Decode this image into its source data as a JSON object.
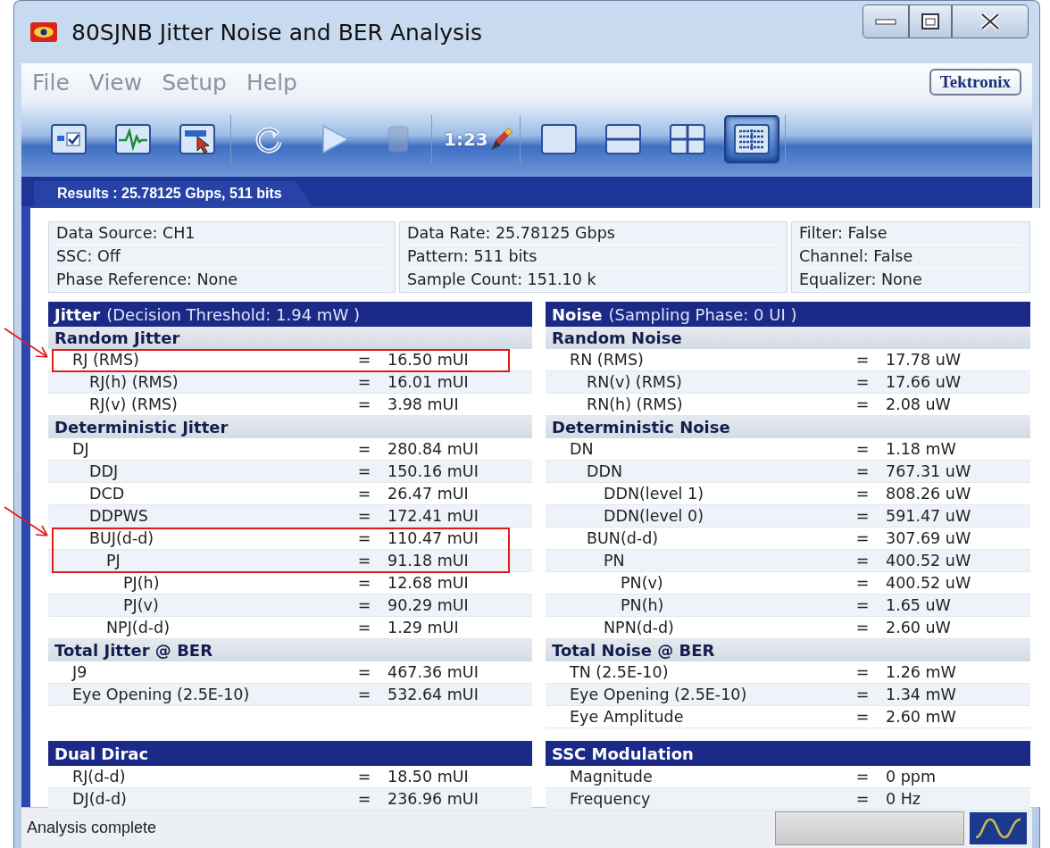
{
  "window": {
    "title": "80SJNB Jitter Noise and BER Analysis"
  },
  "menu": [
    "File",
    "View",
    "Setup",
    "Help"
  ],
  "brand": "Tektronix",
  "toolbar": [
    [
      {
        "kind": "summary",
        "selected": false,
        "disabled": false
      },
      {
        "kind": "waveform",
        "selected": false,
        "disabled": false
      },
      {
        "kind": "select",
        "selected": false,
        "disabled": false
      }
    ],
    [
      {
        "kind": "refresh",
        "selected": false,
        "disabled": false
      },
      {
        "kind": "run",
        "selected": false,
        "disabled": false
      },
      {
        "kind": "stop",
        "selected": false,
        "disabled": true
      }
    ],
    [
      {
        "kind": "numbers",
        "label": "1:23",
        "selected": false,
        "disabled": false
      }
    ],
    [
      {
        "kind": "layout-one",
        "selected": false,
        "disabled": false
      },
      {
        "kind": "layout-two",
        "selected": false,
        "disabled": false
      },
      {
        "kind": "layout-four",
        "selected": false,
        "disabled": false
      },
      {
        "kind": "layout-table",
        "selected": true,
        "disabled": false
      }
    ]
  ],
  "results_tab": {
    "label": "Results : 25.78125 Gbps, 511 bits"
  },
  "info": [
    [
      "Data Source: CH1",
      "SSC: Off",
      "Phase Reference: None"
    ],
    [
      "Data Rate: 25.78125 Gbps",
      "Pattern: 511 bits",
      "Sample Count: 151.10 k"
    ],
    [
      "Filter: False",
      "Channel: False",
      "Equalizer: None"
    ]
  ],
  "left_column": [
    {
      "title": "Jitter",
      "subtitle": "(Decision Threshold: 1.94 mW )",
      "sections": [
        {
          "title": "Random Jitter",
          "rows": [
            {
              "label": "RJ (RMS)",
              "sign": "=",
              "value": "16.50 mUI",
              "highlighted": true,
              "children": [
                {
                  "label": "RJ(h) (RMS)",
                  "sign": "=",
                  "value": "16.01 mUI",
                  "highlighted": false
                },
                {
                  "label": "RJ(v) (RMS)",
                  "sign": "=",
                  "value": "3.98 mUI",
                  "highlighted": false
                }
              ]
            }
          ]
        },
        {
          "title": "Deterministic Jitter",
          "rows": [
            {
              "label": "DJ",
              "sign": "=",
              "value": "280.84 mUI",
              "highlighted": false,
              "children": [
                {
                  "label": "DDJ",
                  "sign": "=",
                  "value": "150.16 mUI",
                  "highlighted": false
                },
                {
                  "label": "DCD",
                  "sign": "=",
                  "value": "26.47 mUI",
                  "highlighted": false
                },
                {
                  "label": "DDPWS",
                  "sign": "=",
                  "value": "172.41 mUI",
                  "highlighted": false
                },
                {
                  "label": "BUJ(d-d)",
                  "sign": "=",
                  "value": "110.47 mUI",
                  "highlighted": true,
                  "children": [
                    {
                      "label": "PJ",
                      "sign": "=",
                      "value": "91.18 mUI",
                      "highlighted": true,
                      "children": [
                        {
                          "label": "PJ(h)",
                          "sign": "=",
                          "value": "12.68 mUI",
                          "highlighted": false
                        },
                        {
                          "label": "PJ(v)",
                          "sign": "=",
                          "value": "90.29 mUI",
                          "highlighted": false
                        }
                      ]
                    },
                    {
                      "label": "NPJ(d-d)",
                      "sign": "=",
                      "value": "1.29 mUI",
                      "highlighted": false
                    }
                  ]
                }
              ]
            }
          ]
        },
        {
          "title": "Total Jitter @ BER",
          "rows": [
            {
              "label": "J9",
              "sign": "=",
              "value": "467.36 mUI",
              "highlighted": false
            },
            {
              "label": "Eye Opening (2.5E-10)",
              "sign": "=",
              "value": "532.64 mUI",
              "highlighted": false
            }
          ]
        }
      ]
    },
    {
      "title": "Dual Dirac",
      "sections": [
        {
          "rows": [
            {
              "label": "RJ(d-d)",
              "sign": "=",
              "value": "18.50 mUI",
              "highlighted": false
            },
            {
              "label": "DJ(d-d)",
              "sign": "=",
              "value": "236.96 mUI",
              "highlighted": false
            }
          ]
        }
      ]
    }
  ],
  "right_column": [
    {
      "title": "Noise",
      "subtitle": "(Sampling Phase: 0 UI )",
      "sections": [
        {
          "title": "Random Noise",
          "rows": [
            {
              "label": "RN (RMS)",
              "sign": "=",
              "value": "17.78 uW",
              "highlighted": false,
              "children": [
                {
                  "label": "RN(v) (RMS)",
                  "sign": "=",
                  "value": "17.66 uW",
                  "highlighted": false
                },
                {
                  "label": "RN(h) (RMS)",
                  "sign": "=",
                  "value": "2.08 uW",
                  "highlighted": false
                }
              ]
            }
          ]
        },
        {
          "title": "Deterministic Noise",
          "rows": [
            {
              "label": "DN",
              "sign": "=",
              "value": "1.18 mW",
              "highlighted": false,
              "children": [
                {
                  "label": "DDN",
                  "sign": "=",
                  "value": "767.31 uW",
                  "highlighted": false,
                  "children": [
                    {
                      "label": "DDN(level 1)",
                      "sign": "=",
                      "value": "808.26 uW",
                      "highlighted": false
                    },
                    {
                      "label": "DDN(level 0)",
                      "sign": "=",
                      "value": "591.47 uW",
                      "highlighted": false
                    }
                  ]
                },
                {
                  "label": "BUN(d-d)",
                  "sign": "=",
                  "value": "307.69 uW",
                  "highlighted": false,
                  "children": [
                    {
                      "label": "PN",
                      "sign": "=",
                      "value": "400.52 uW",
                      "highlighted": false,
                      "children": [
                        {
                          "label": "PN(v)",
                          "sign": "=",
                          "value": "400.52 uW",
                          "highlighted": false
                        },
                        {
                          "label": "PN(h)",
                          "sign": "=",
                          "value": "1.65 uW",
                          "highlighted": false
                        }
                      ]
                    },
                    {
                      "label": "NPN(d-d)",
                      "sign": "=",
                      "value": "2.60 uW",
                      "highlighted": false
                    }
                  ]
                }
              ]
            }
          ]
        },
        {
          "title": "Total Noise @ BER",
          "rows": [
            {
              "label": "TN (2.5E-10)",
              "sign": "=",
              "value": "1.26 mW",
              "highlighted": false
            },
            {
              "label": "Eye Opening (2.5E-10)",
              "sign": "=",
              "value": "1.34 mW",
              "highlighted": false
            },
            {
              "label": "Eye Amplitude",
              "sign": "=",
              "value": "2.60 mW",
              "highlighted": false
            }
          ]
        }
      ]
    },
    {
      "title": "SSC Modulation",
      "sections": [
        {
          "rows": [
            {
              "label": "Magnitude",
              "sign": "=",
              "value": "0 ppm",
              "highlighted": false
            },
            {
              "label": "Frequency",
              "sign": "=",
              "value": "0 Hz",
              "highlighted": false
            }
          ]
        }
      ]
    }
  ],
  "status_bar": {
    "message": "Analysis complete"
  }
}
